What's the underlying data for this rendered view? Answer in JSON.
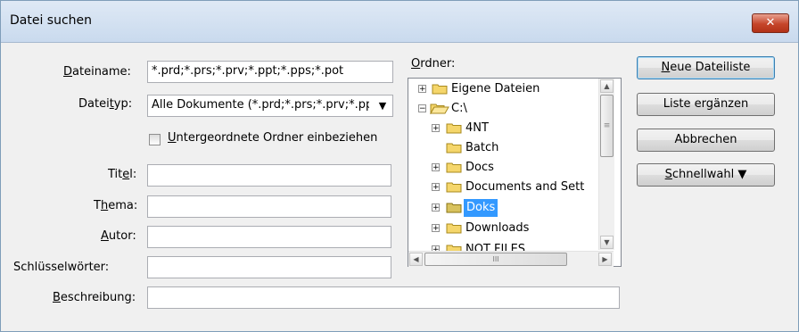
{
  "window": {
    "title": "Datei suchen",
    "close_glyph": "✕"
  },
  "labels": {
    "filename_pre": "",
    "filename_acc": "D",
    "filename_post": "ateiname:",
    "filetype_pre": "Datei",
    "filetype_acc": "t",
    "filetype_post": "yp:",
    "subfolders_acc": "U",
    "subfolders_post": "ntergeordnete Ordner einbeziehen",
    "title_pre": "Tit",
    "title_acc": "e",
    "title_post": "l:",
    "subject_pre": "T",
    "subject_acc": "h",
    "subject_post": "ema:",
    "author_pre": "",
    "author_acc": "A",
    "author_post": "utor:",
    "keywords": "Schlüsselwörter:",
    "description_pre": "",
    "description_acc": "B",
    "description_post": "eschreibung:",
    "folder_acc": "O",
    "folder_post": "rdner:"
  },
  "fields": {
    "filename_value": "*.prd;*.prs;*.prv;*.ppt;*.pps;*.pot",
    "filetype_value": "Alle Dokumente (*.prd;*.prs;*.prv;*.pp",
    "title_value": "",
    "subject_value": "",
    "author_value": "",
    "keywords_value": "",
    "description_value": ""
  },
  "tree": {
    "items": [
      {
        "label": "Eigene Dateien",
        "expander": "+",
        "open": false
      },
      {
        "label": "C:\\",
        "expander": "−",
        "open": true
      },
      {
        "label": "4NT",
        "expander": "+",
        "open": false
      },
      {
        "label": "Batch",
        "expander": "",
        "open": false
      },
      {
        "label": "Docs",
        "expander": "+",
        "open": false
      },
      {
        "label": "Documents and Sett",
        "expander": "+",
        "open": false
      },
      {
        "label": "Doks",
        "expander": "+",
        "open": false,
        "selected": true
      },
      {
        "label": "Downloads",
        "expander": "+",
        "open": false
      },
      {
        "label": "NOT FILES",
        "expander": "+",
        "open": false
      }
    ]
  },
  "scroll": {
    "up": "▲",
    "down": "▼",
    "left": "◀",
    "right": "▶",
    "grip": "III",
    "vgrip": "≡"
  },
  "buttons": {
    "new_list_acc": "N",
    "new_list_post": "eue Dateiliste",
    "append_list": "Liste ergänzen",
    "cancel": "Abbrechen",
    "quick_acc": "S",
    "quick_post": "chnellwahl ▼"
  },
  "colors": {
    "selection": "#3399ff",
    "folder": "#f5d66b"
  }
}
